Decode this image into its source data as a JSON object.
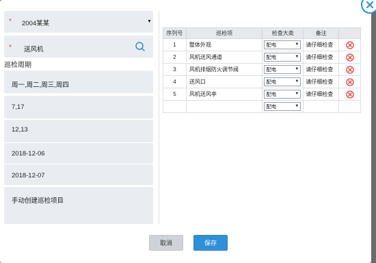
{
  "form": {
    "code_select": {
      "required_mark": "*",
      "value": "2004某某"
    },
    "device": {
      "required_mark": "*",
      "label": "",
      "value": "送风机"
    },
    "cycle_title": "巡检周期",
    "weekdays": {
      "label": "",
      "value": "周一,周二,周三,周四"
    },
    "months": {
      "label": "",
      "value": "7,17"
    },
    "hours": {
      "label": "",
      "value": "12,13"
    },
    "start_date": {
      "label": "",
      "value": "2018-12-06"
    },
    "end_date": {
      "label": "",
      "value": "2018-12-07"
    },
    "remark": {
      "label": "",
      "value": "手动创建巡检项目"
    }
  },
  "table": {
    "headers": [
      "序列号",
      "巡检项",
      "检查大类",
      "备注"
    ],
    "rows": [
      {
        "no": "1",
        "item": "整体外观",
        "category": "配电",
        "note": "请仔细检查"
      },
      {
        "no": "2",
        "item": "风机送风通道",
        "category": "配电",
        "note": "请仔细检查"
      },
      {
        "no": "3",
        "item": "风机排烟防火调节阀",
        "category": "配电",
        "note": "请仔细检查"
      },
      {
        "no": "4",
        "item": "送风口",
        "category": "配电",
        "note": "请仔细检查"
      },
      {
        "no": "5",
        "item": "风机送风亭",
        "category": "配电",
        "note": "请仔细检查"
      }
    ],
    "new_row": {
      "category": "配电"
    }
  },
  "buttons": {
    "cancel": "取消",
    "save": "保存"
  },
  "colors": {
    "accent": "#2f8fd8",
    "delete": "#e23b3b",
    "field_bg": "#e9edf1"
  },
  "icons": {
    "close": "close-icon",
    "search": "search-icon",
    "delete": "delete-row-icon",
    "dropdown": "chevron-down-icon"
  }
}
